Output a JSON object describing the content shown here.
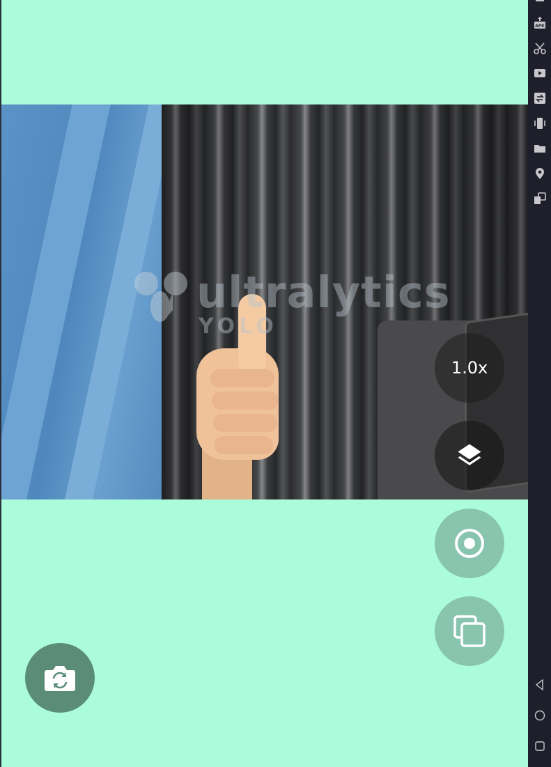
{
  "watermark": {
    "brand": "ultralytics",
    "sub": "YOLO"
  },
  "controls": {
    "zoom_label": "1.0x",
    "layers_icon": "layers-icon",
    "record_icon": "record-icon",
    "copy_icon": "copy-icon",
    "switch_camera_icon": "camera-switch-icon"
  },
  "sidebar": {
    "items": [
      {
        "name": "apk-install",
        "label": "APK"
      },
      {
        "name": "scissors"
      },
      {
        "name": "screen-record"
      },
      {
        "name": "sync"
      },
      {
        "name": "shake"
      },
      {
        "name": "folder"
      },
      {
        "name": "location"
      },
      {
        "name": "multi-window"
      }
    ],
    "nav": [
      "back",
      "home",
      "recents"
    ]
  },
  "colors": {
    "background": "#abfcdb",
    "fab_light": "#89c5ae",
    "fab_dark": "#5b8c78",
    "sidebar": "#1e1f2b"
  }
}
